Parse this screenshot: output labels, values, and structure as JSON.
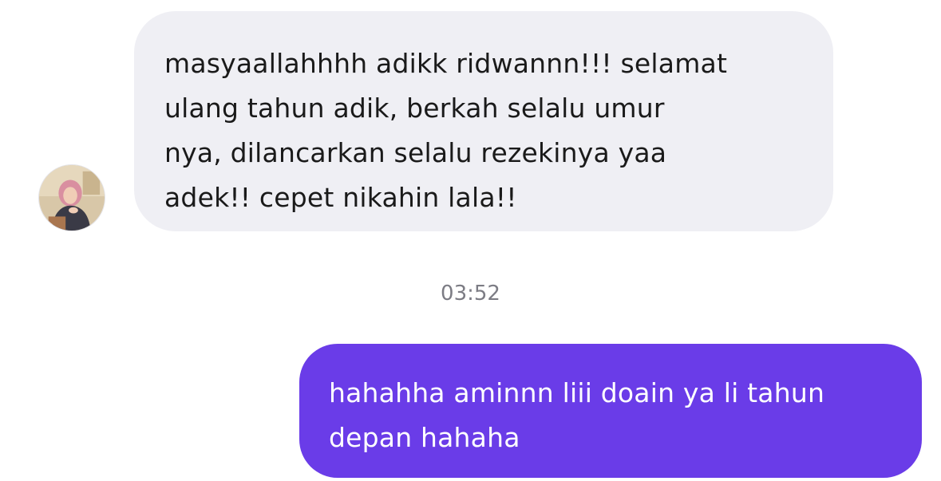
{
  "incoming": {
    "lines": [
      "masyaallahhhh adikk ridwannn!!! selamat",
      "ulang tahun adik, berkah selalu umur",
      "nya, dilancarkan selalu rezekinya yaa",
      "adek!! cepet nikahin lala!!"
    ],
    "avatar_icon": "profile-photo",
    "bubble_color": "#efeff4"
  },
  "timestamp": "03:52",
  "outgoing": {
    "lines": [
      "hahahha aminnn liii doain ya li tahun",
      "depan hahaha"
    ],
    "bubble_color": "#6a3ce8"
  }
}
